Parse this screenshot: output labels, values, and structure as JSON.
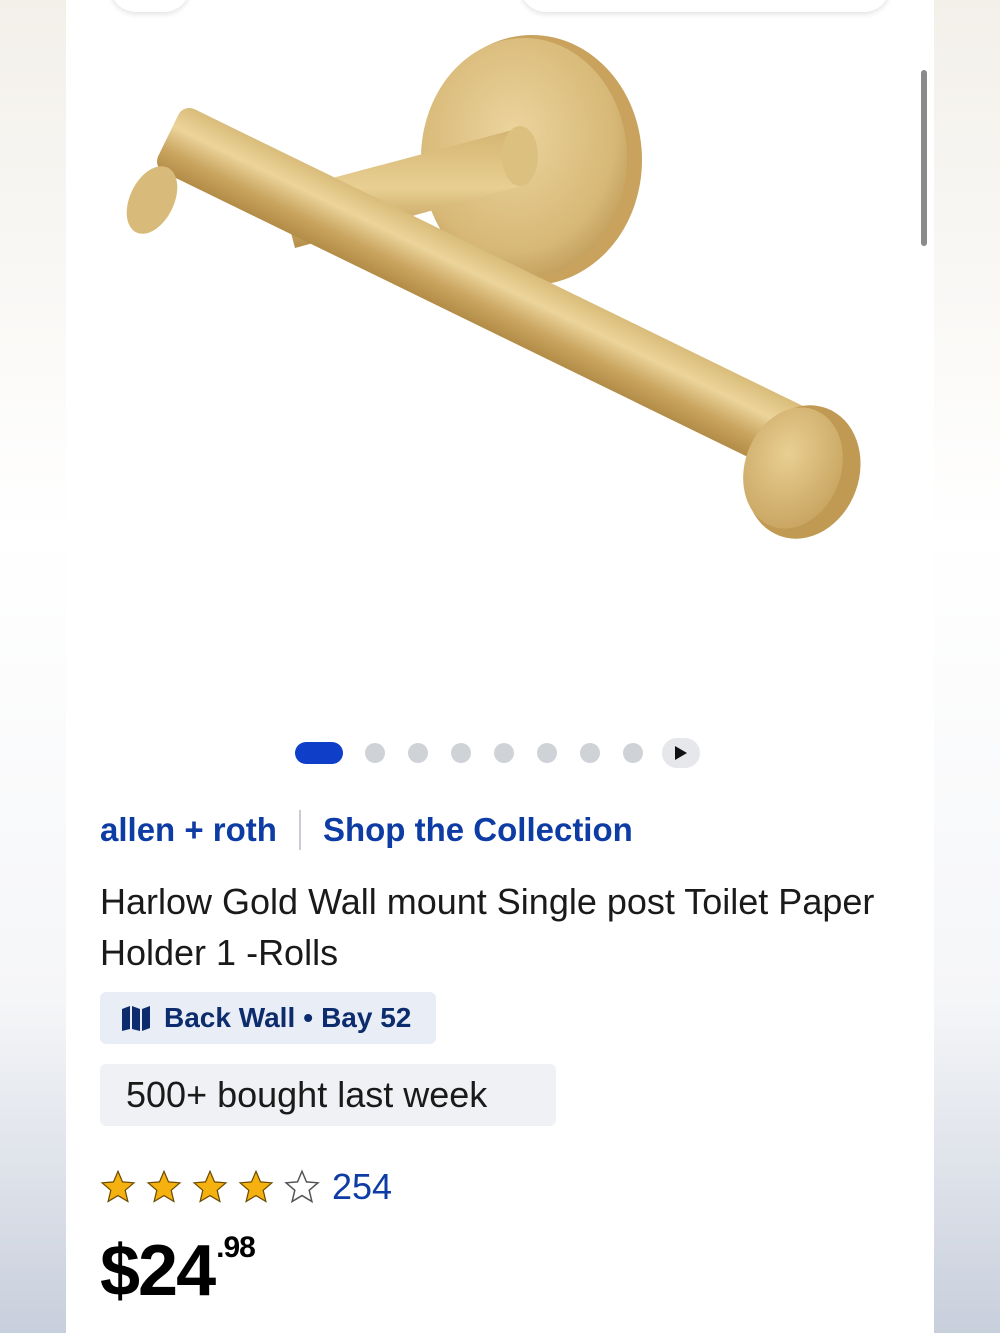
{
  "product": {
    "brand": "allen + roth",
    "collection_link": "Shop the Collection",
    "title": "Harlow Gold Wall mount Single post Toilet Paper Holder 1 -Rolls",
    "image_icon": "toilet-paper-holder-image"
  },
  "carousel": {
    "total_dots": 8,
    "active_index": 0,
    "play_icon": "play-icon"
  },
  "location": {
    "icon": "map-icon",
    "aisle": "Back Wall",
    "separator": "•",
    "bay": "Bay 52"
  },
  "social_proof": {
    "text": "500+ bought last week"
  },
  "rating": {
    "value": 4,
    "max": 5,
    "count": "254"
  },
  "price": {
    "dollars": "$24",
    "cents": ".98"
  },
  "colors": {
    "brand_blue": "#0e3ca5",
    "carousel_active": "#0f3fc8",
    "star_gold": "#f4b10f",
    "location_chip_bg": "#e8edf6",
    "location_text": "#0c2c6d"
  }
}
